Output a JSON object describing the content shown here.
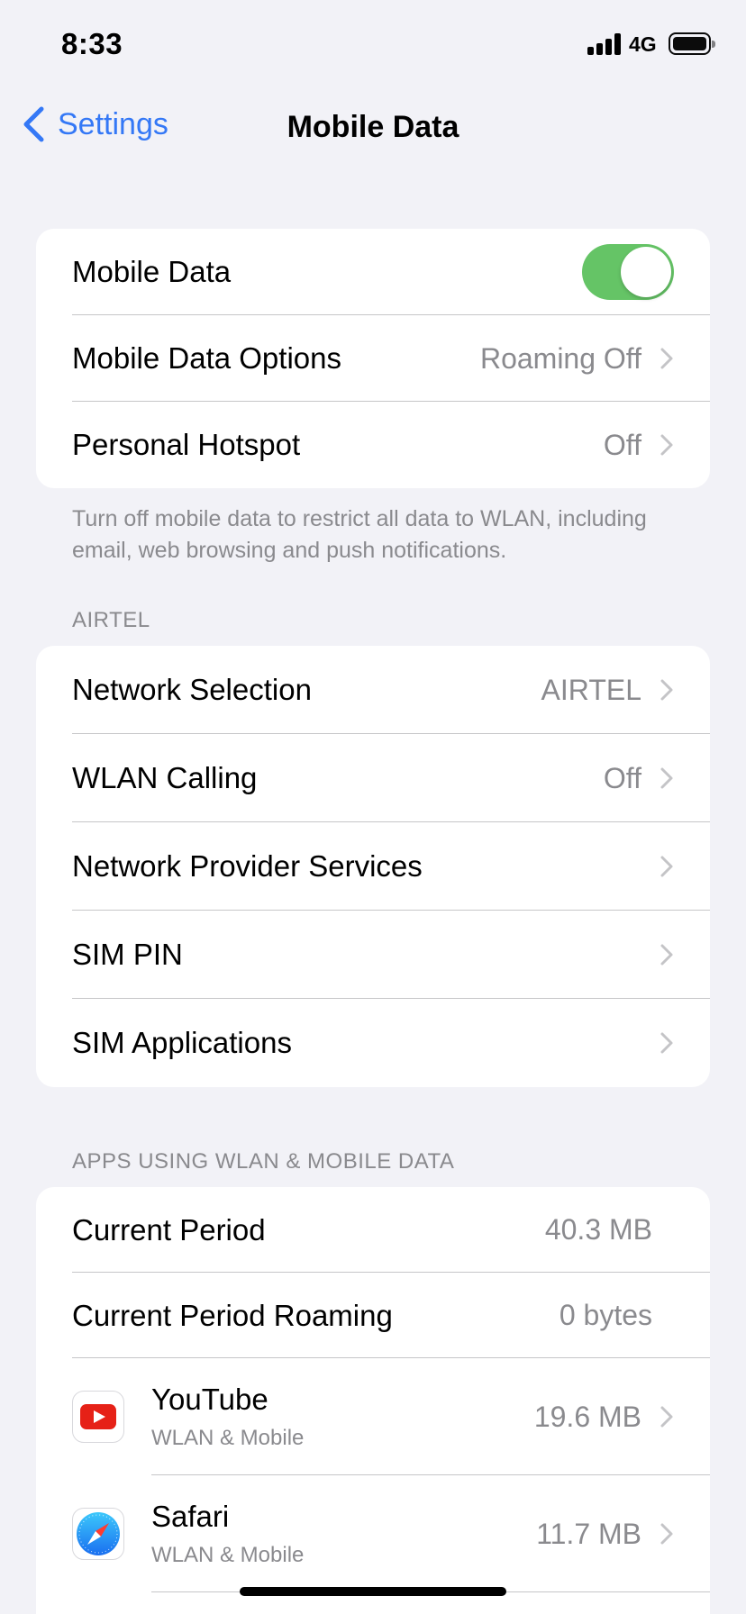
{
  "status_bar": {
    "time": "8:33",
    "network": "4G"
  },
  "nav": {
    "back_label": "Settings",
    "title": "Mobile Data"
  },
  "group1": {
    "mobile_data_label": "Mobile Data",
    "mobile_data_on": true,
    "options_label": "Mobile Data Options",
    "options_value": "Roaming Off",
    "hotspot_label": "Personal Hotspot",
    "hotspot_value": "Off"
  },
  "footnote": "Turn off mobile data to restrict all data to WLAN, including email, web browsing and push notifications.",
  "carrier_section": {
    "header": "AIRTEL",
    "rows": [
      {
        "label": "Network Selection",
        "value": "AIRTEL"
      },
      {
        "label": "WLAN Calling",
        "value": "Off"
      },
      {
        "label": "Network Provider Services",
        "value": ""
      },
      {
        "label": "SIM PIN",
        "value": ""
      },
      {
        "label": "SIM Applications",
        "value": ""
      }
    ]
  },
  "apps_section": {
    "header": "APPS USING WLAN & MOBILE DATA",
    "current_period_label": "Current Period",
    "current_period_value": "40.3 MB",
    "roaming_label": "Current Period Roaming",
    "roaming_value": "0 bytes",
    "apps": [
      {
        "name": "YouTube",
        "sub": "WLAN & Mobile",
        "usage": "19.6 MB",
        "icon": "youtube-icon"
      },
      {
        "name": "Safari",
        "sub": "WLAN & Mobile",
        "usage": "11.7 MB",
        "icon": "safari-icon"
      }
    ]
  },
  "colors": {
    "accent": "#3478f6",
    "toggle_on": "#65c466",
    "background": "#f2f2f7"
  }
}
